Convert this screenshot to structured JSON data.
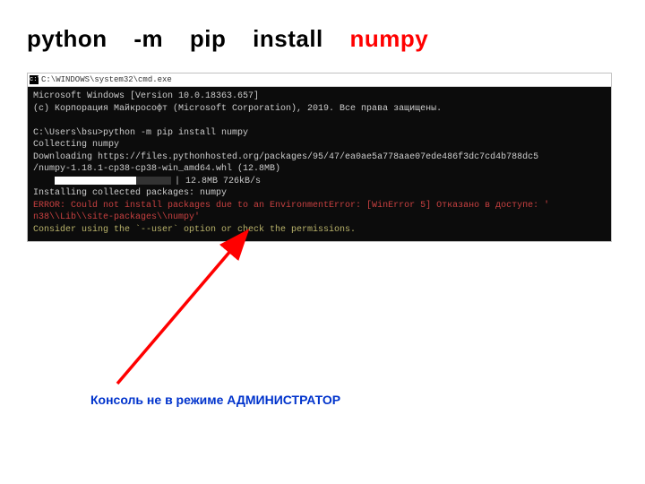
{
  "title": {
    "w1": "python",
    "w2": "-m",
    "w3": "pip",
    "w4": "install",
    "pkg": "numpy"
  },
  "terminal": {
    "window_title": "C:\\WINDOWS\\system32\\cmd.exe",
    "line_version": "Microsoft Windows [Version 10.0.18363.657]",
    "line_copyright": "(c) Корпорация Майкрософт (Microsoft Corporation), 2019. Все права защищены.",
    "line_prompt": "C:\\Users\\bsu>python -m pip install numpy",
    "line_collecting": "Collecting numpy",
    "line_download": "  Downloading https://files.pythonhosted.org/packages/95/47/ea0ae5a778aae07ede486f3dc7cd4b788dc5",
    "line_wheel": "/numpy-1.18.1-cp38-cp38-win_amd64.whl (12.8MB)",
    "progress_text": "| 12.8MB 726kB/s",
    "line_installing": "Installing collected packages: numpy",
    "line_error": "ERROR: Could not install packages due to an EnvironmentError: [WinError 5] Отказано в доступе: '",
    "line_error2": "n38\\\\Lib\\\\site-packages\\\\numpy'",
    "line_suggest": "Consider using the `--user` option or check the permissions."
  },
  "annotation": "Консоль не в режиме АДМИНИСТРАТОР"
}
